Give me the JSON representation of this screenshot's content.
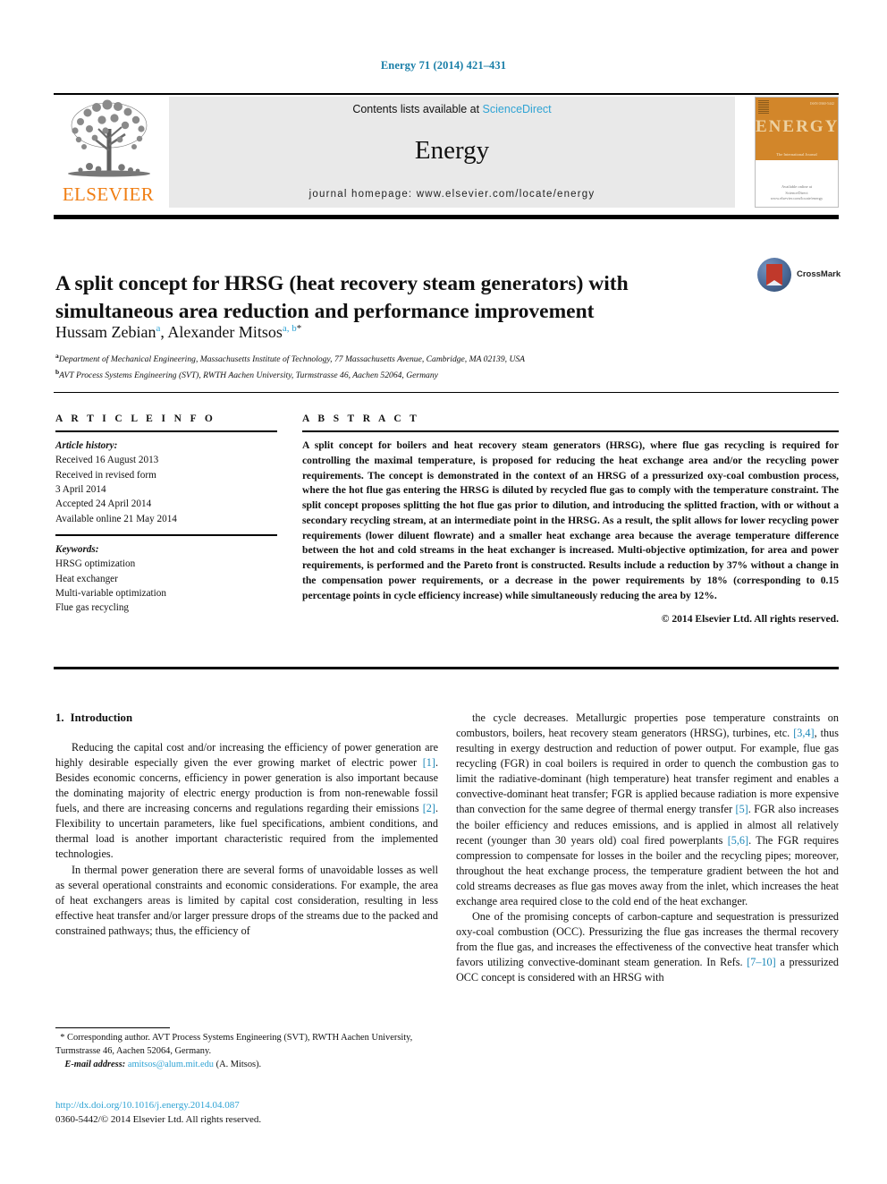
{
  "running_head": "Energy 71 (2014) 421–431",
  "header": {
    "contents_prefix": "Contents lists available at ",
    "sciencedirect": "ScienceDirect",
    "journal_title": "Energy",
    "homepage": "journal homepage: www.elsevier.com/locate/energy",
    "elsevier_wordmark": "ELSEVIER",
    "cover": {
      "title": "ENERGY",
      "subtitle": "The International Journal",
      "corner": "ISSN 0360-5442",
      "footer_line1": "Available online at",
      "footer_line2": "ScienceDirect",
      "footer_line3": "www.elsevier.com/locate/energy"
    }
  },
  "article": {
    "title": "A split concept for HRSG (heat recovery steam generators) with simultaneous area reduction and performance improvement",
    "crossmark_label": "CrossMark",
    "authors": [
      {
        "name": "Hussam Zebian",
        "marks": "a"
      },
      {
        "name": "Alexander Mitsos",
        "marks": "a, b",
        "corresponding": "*"
      }
    ],
    "affiliations": [
      {
        "mark": "a",
        "text": "Department of Mechanical Engineering, Massachusetts Institute of Technology, 77 Massachusetts Avenue, Cambridge, MA 02139, USA"
      },
      {
        "mark": "b",
        "text": "AVT Process Systems Engineering (SVT), RWTH Aachen University, Turmstrasse 46, Aachen 52064, Germany"
      }
    ]
  },
  "info": {
    "heading": "A R T I C L E   I N F O",
    "history_label": "Article history:",
    "history": [
      "Received 16 August 2013",
      "Received in revised form",
      "3 April 2014",
      "Accepted 24 April 2014",
      "Available online 21 May 2014"
    ],
    "keywords_label": "Keywords:",
    "keywords": [
      "HRSG optimization",
      "Heat exchanger",
      "Multi-variable optimization",
      "Flue gas recycling"
    ]
  },
  "abstract": {
    "heading": "A B S T R A C T",
    "text": "A split concept for boilers and heat recovery steam generators (HRSG), where flue gas recycling is required for controlling the maximal temperature, is proposed for reducing the heat exchange area and/or the recycling power requirements. The concept is demonstrated in the context of an HRSG of a pressurized oxy-coal combustion process, where the hot flue gas entering the HRSG is diluted by recycled flue gas to comply with the temperature constraint. The split concept proposes splitting the hot flue gas prior to dilution, and introducing the splitted fraction, with or without a secondary recycling stream, at an intermediate point in the HRSG. As a result, the split allows for lower recycling power requirements (lower diluent flowrate) and a smaller heat exchange area because the average temperature difference between the hot and cold streams in the heat exchanger is increased. Multi-objective optimization, for area and power requirements, is performed and the Pareto front is constructed. Results include a reduction by 37% without a change in the compensation power requirements, or a decrease in the power requirements by 18% (corresponding to 0.15 percentage points in cycle efficiency increase) while simultaneously reducing the area by 12%.",
    "copyright": "© 2014 Elsevier Ltd. All rights reserved."
  },
  "body": {
    "section_number": "1.",
    "section_title": "Introduction",
    "left_paragraphs": [
      "Reducing the capital cost and/or increasing the efficiency of power generation are highly desirable especially given the ever growing market of electric power [1]. Besides economic concerns, efficiency in power generation is also important because the dominating majority of electric energy production is from non-renewable fossil fuels, and there are increasing concerns and regulations regarding their emissions [2]. Flexibility to uncertain parameters, like fuel specifications, ambient conditions, and thermal load is another important characteristic required from the implemented technologies.",
      "In thermal power generation there are several forms of unavoidable losses as well as several operational constraints and economic considerations. For example, the area of heat exchangers areas is limited by capital cost consideration, resulting in less effective heat transfer and/or larger pressure drops of the streams due to the packed and constrained pathways; thus, the efficiency of"
    ],
    "right_paragraphs": [
      "the cycle decreases. Metallurgic properties pose temperature constraints on combustors, boilers, heat recovery steam generators (HRSG), turbines, etc. [3,4], thus resulting in exergy destruction and reduction of power output. For example, flue gas recycling (FGR) in coal boilers is required in order to quench the combustion gas to limit the radiative-dominant (high temperature) heat transfer regiment and enables a convective-dominant heat transfer; FGR is applied because radiation is more expensive than convection for the same degree of thermal energy transfer [5]. FGR also increases the boiler efficiency and reduces emissions, and is applied in almost all relatively recent (younger than 30 years old) coal fired powerplants [5,6]. The FGR requires compression to compensate for losses in the boiler and the recycling pipes; moreover, throughout the heat exchange process, the temperature gradient between the hot and cold streams decreases as flue gas moves away from the inlet, which increases the heat exchange area required close to the cold end of the heat exchanger.",
      "One of the promising concepts of carbon-capture and sequestration is pressurized oxy-coal combustion (OCC). Pressurizing the flue gas increases the thermal recovery from the flue gas, and increases the effectiveness of the convective heat transfer which favors utilizing convective-dominant steam generation. In Refs. [7–10] a pressurized OCC concept is considered with an HRSG with"
    ]
  },
  "footer": {
    "corresponding_star": "*",
    "corresponding_text": "Corresponding author. AVT Process Systems Engineering (SVT), RWTH Aachen University, Turmstrasse 46, Aachen 52064, Germany.",
    "email_label": "E-mail address:",
    "email": "amitsos@alum.mit.edu",
    "email_suffix": "(A. Mitsos).",
    "doi": "http://dx.doi.org/10.1016/j.energy.2014.04.087",
    "issn_line": "0360-5442/© 2014 Elsevier Ltd. All rights reserved."
  },
  "colors": {
    "link_blue": "#2fa3d4",
    "ref_blue": "#1c87b8",
    "elsevier_orange": "#f07e13",
    "cover_orange": "#d2862a",
    "running_head_blue": "#1a7fa8"
  }
}
